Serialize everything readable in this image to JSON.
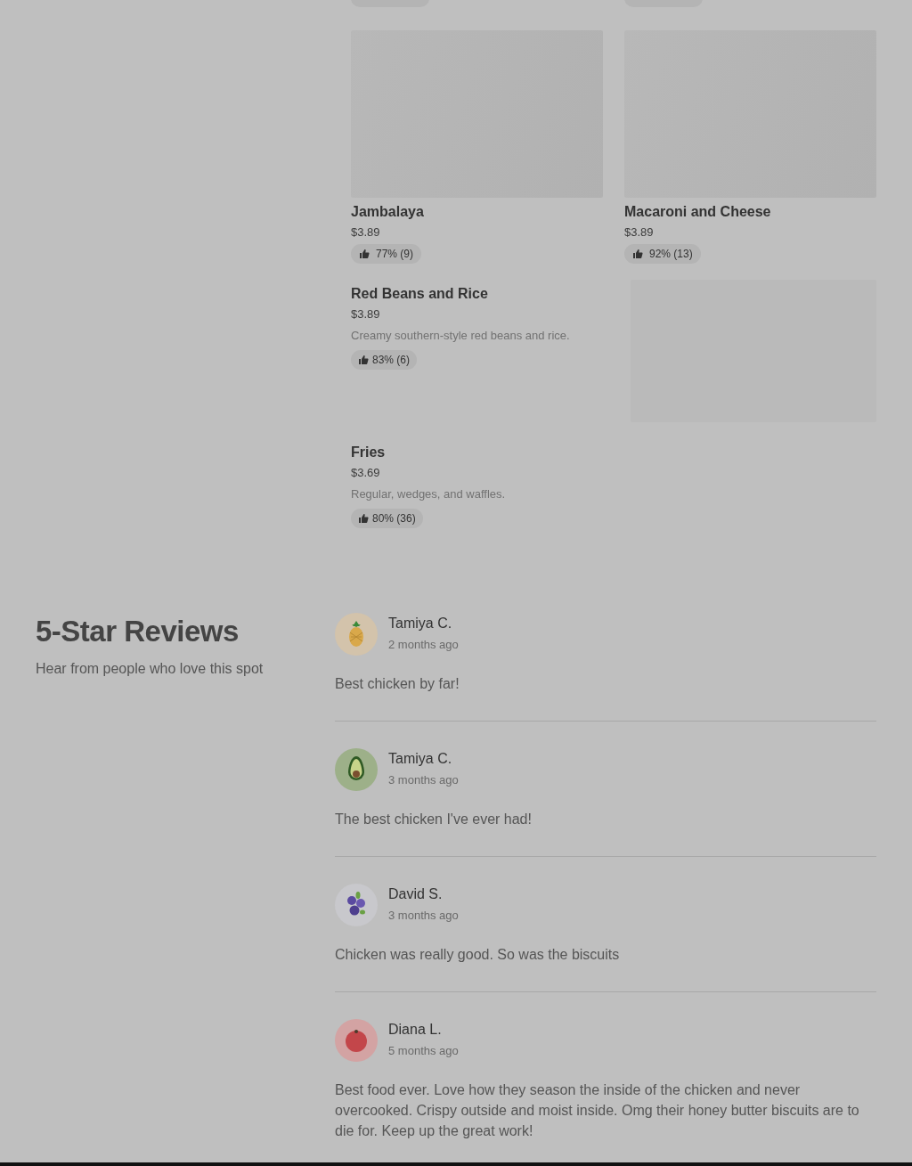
{
  "menu": {
    "items": [
      {
        "kind": "stacked",
        "name": "Jambalaya",
        "price": "$3.89",
        "rating": "77% (9)"
      },
      {
        "kind": "stacked",
        "name": "Macaroni and Cheese",
        "price": "$3.89",
        "rating": "92% (13)"
      },
      {
        "kind": "side",
        "name": "Red Beans and Rice",
        "price": "$3.89",
        "description": "Creamy southern-style red beans and rice.",
        "rating": "83% (6)"
      },
      {
        "kind": "plain",
        "name": "Fries",
        "price": "$3.69",
        "description": "Regular, wedges, and waffles.",
        "rating": "80% (36)"
      }
    ]
  },
  "reviews": {
    "title": "5-Star Reviews",
    "subtitle": "Hear from people who love this spot",
    "items": [
      {
        "kind": "pineapple",
        "name": "Tamiya C.",
        "date": "2 months ago",
        "text": "Best chicken by far!"
      },
      {
        "kind": "avocado",
        "name": "Tamiya C.",
        "date": "3 months ago",
        "text": "The best chicken I've ever had!"
      },
      {
        "kind": "blueberry",
        "name": "David S.",
        "date": "3 months ago",
        "text": "Chicken was really good. So was the biscuits"
      },
      {
        "kind": "tomato",
        "name": "Diana L.",
        "date": "5 months ago",
        "text": "Best food ever. Love how they season the inside of the chicken and never overcooked. Crispy outside and moist inside. Omg their honey butter biscuits are to die for. Keep up the great work!"
      }
    ]
  }
}
